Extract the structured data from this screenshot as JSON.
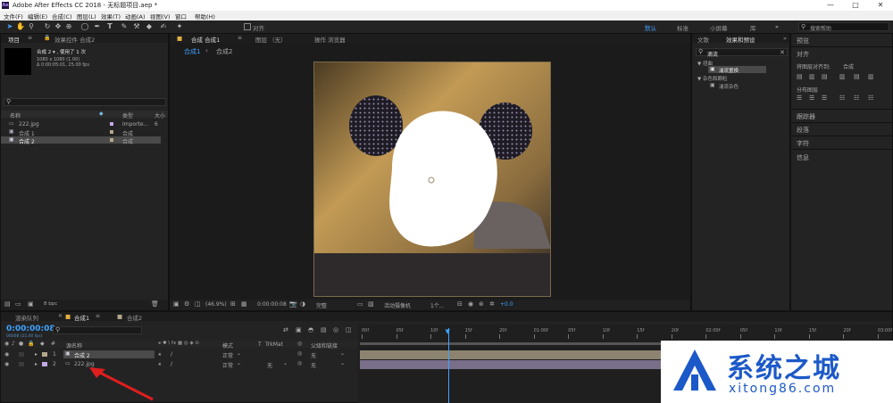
{
  "window": {
    "title": "Adobe After Effects CC 2018 - 无标题项目.aep *",
    "app_icon": "Ae",
    "minimize": "—",
    "maximize": "□",
    "close": "✕"
  },
  "menu": [
    "文件(F)",
    "编辑(E)",
    "合成(C)",
    "图层(L)",
    "效果(T)",
    "动画(A)",
    "视图(V)",
    "窗口",
    "帮助(H)"
  ],
  "toolbar": {
    "align_label": "对齐",
    "workspaces": [
      "默认",
      "标准",
      "小屏幕",
      "库"
    ],
    "search_placeholder": "搜索帮助"
  },
  "project": {
    "tab_label": "项目",
    "effect_controls_tab": "效果控件 合成2",
    "item_name": "合成 2 ▾ , 使用了 1 次",
    "item_info": [
      "1080 x 1080 (1.00)",
      "Δ 0:00:05:01, 25.00 fps"
    ],
    "search_placeholder": "",
    "columns": [
      "名称",
      "类型",
      "大小"
    ],
    "items": [
      {
        "name": "222.jpg",
        "type": "Importe...",
        "size": "6"
      },
      {
        "name": "合成 1",
        "type": "合成",
        "size": ""
      },
      {
        "name": "合成 2",
        "type": "合成",
        "size": ""
      }
    ],
    "bpc": "8 bpc"
  },
  "composition": {
    "tab_label": "合成 合成1",
    "layer_tab": "图层 （无）",
    "flow_tab": "操作 浏览器",
    "breadcrumbs": [
      "合成1",
      "合成2"
    ],
    "zoom": "(46.9%)",
    "timecode": "0:00:00:08",
    "resolution": "完整",
    "camera": "活动摄像机",
    "views": "1个...",
    "exposure": "+0.0"
  },
  "right_panel": {
    "tabs": [
      "文散",
      "效果和预设"
    ],
    "search_value": "滴流",
    "tree": [
      {
        "label": "▼ 扭曲",
        "indent": false
      },
      {
        "label": "湍流置换",
        "indent": true,
        "selected": true
      },
      {
        "label": "▼ 杂色和颗粒",
        "indent": false
      },
      {
        "label": "湍流杂色",
        "indent": true,
        "selected": false
      }
    ]
  },
  "far_right": {
    "preview": "预览",
    "align": "对齐",
    "align_to_label": "将图层对齐到:",
    "align_to_value": "合成",
    "distribute": "分布图层",
    "sections": [
      "跟踪器",
      "段落",
      "字符",
      "信息"
    ]
  },
  "timeline": {
    "tabs": [
      "渲染队列",
      "合成1",
      "合成2"
    ],
    "timecode": "0:00:00:08",
    "timecode_sub": "00008 (25.00 fps)",
    "columns": [
      "源名称",
      "模式",
      "T",
      "TrkMat",
      "父级和链接"
    ],
    "layers": [
      {
        "num": "1",
        "name": "合成 2",
        "mode": "正常",
        "trkmat": "",
        "parent": "无",
        "color": "#b3a88a"
      },
      {
        "num": "2",
        "name": "222.jpg",
        "mode": "正常",
        "trkmat": "无",
        "parent": "无",
        "color": "#c4a8e8"
      }
    ],
    "ruler": [
      "00f",
      "05f",
      "10f",
      "15f",
      "20f",
      "01:00f",
      "05f",
      "10f",
      "15f",
      "20f",
      "02:00f",
      "05f",
      "10f",
      "15f",
      "20f",
      "03:00f"
    ],
    "playhead_fraction": 0.167
  },
  "watermark": {
    "name": "系统之城",
    "url": "xitong86.com"
  }
}
